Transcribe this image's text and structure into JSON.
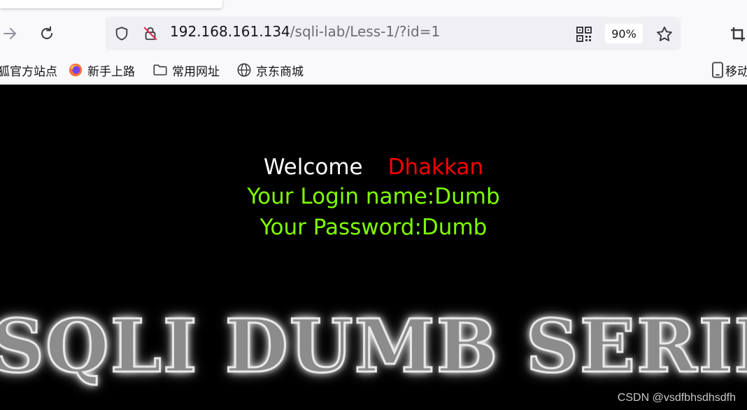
{
  "browser": {
    "url_host": "192.168.161.134",
    "url_path": "/sqli-lab/Less-1/?id=1",
    "zoom": "90%"
  },
  "bookmarks": [
    {
      "label": "狐官方站点",
      "icon": "firefox-icon"
    },
    {
      "label": "新手上路",
      "icon": "firefox-icon"
    },
    {
      "label": "常用网址",
      "icon": "folder-icon"
    },
    {
      "label": "京东商城",
      "icon": "globe-icon"
    },
    {
      "label": "移动",
      "icon": "mobile-icon"
    }
  ],
  "page": {
    "welcome": "Welcome",
    "username": "Dhakkan",
    "login_line": "Your Login name:Dumb",
    "password_line": "Your Password:Dumb",
    "banner": "SQLI DUMB SERIES"
  },
  "watermark": "CSDN @vsdfbhsdhsdfh",
  "colors": {
    "welcome": "#ffffff",
    "username": "#ff0000",
    "info": "#7fff00",
    "background": "#000000"
  }
}
